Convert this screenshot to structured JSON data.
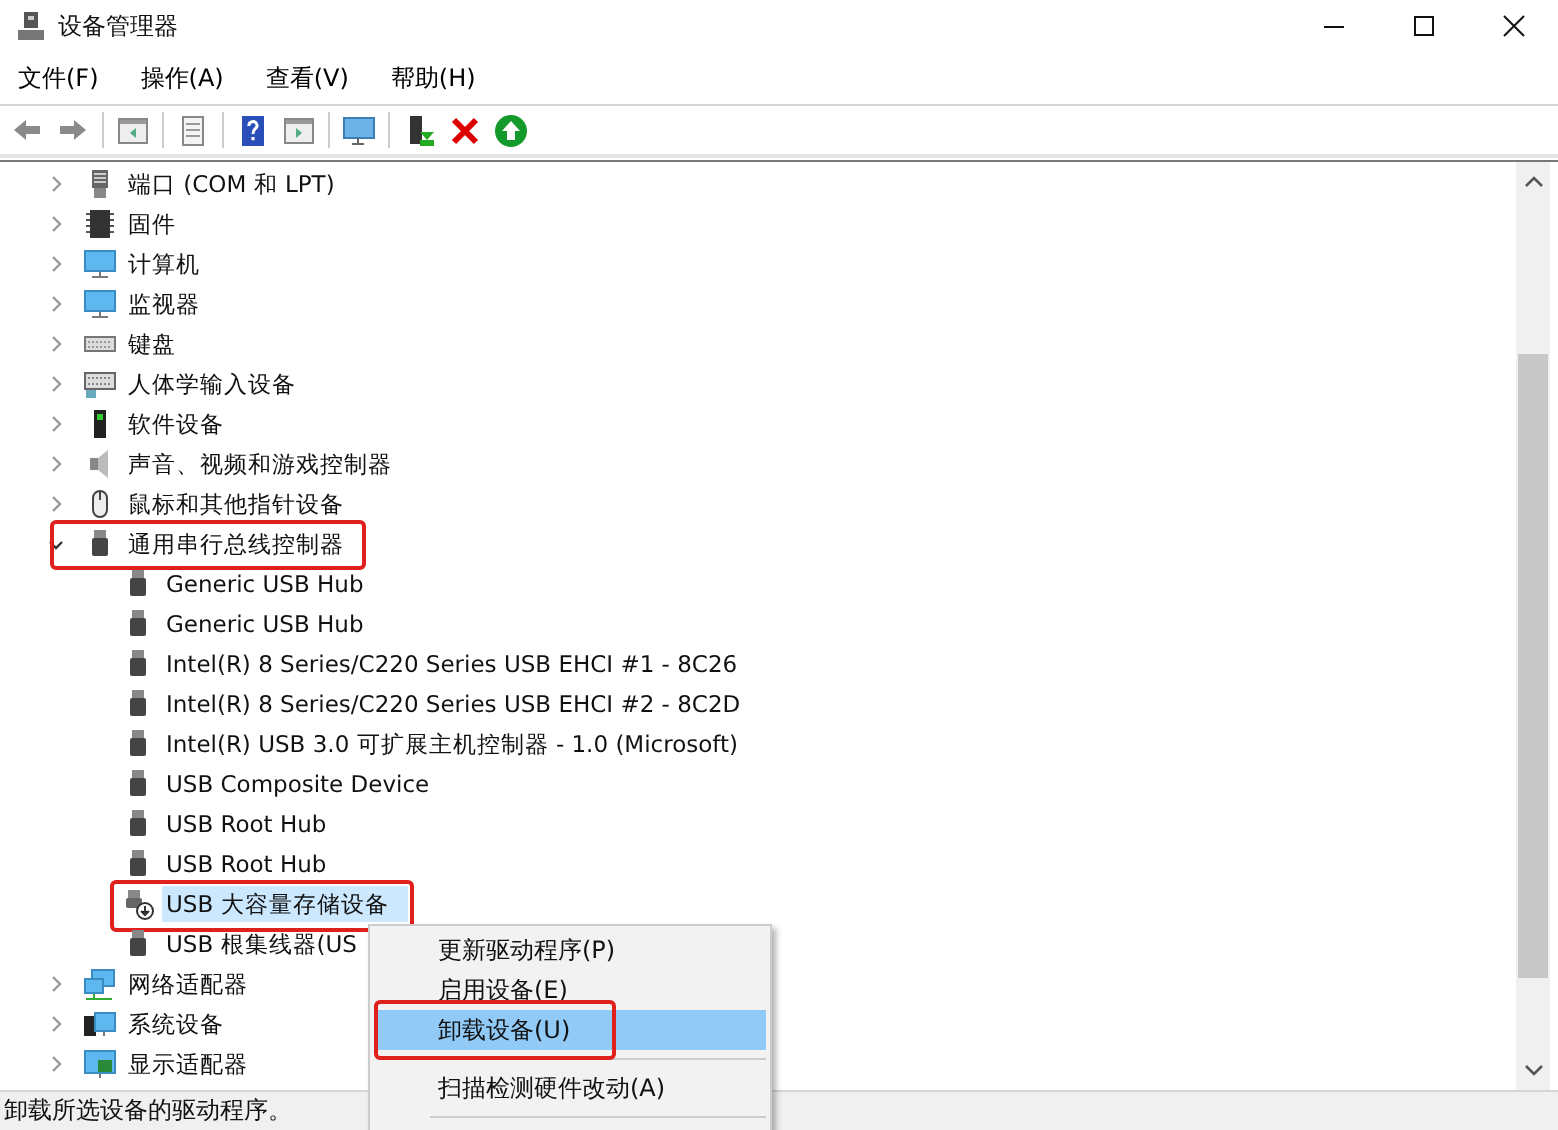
{
  "window": {
    "title": "设备管理器"
  },
  "menu": [
    "文件(F)",
    "操作(A)",
    "查看(V)",
    "帮助(H)"
  ],
  "toolbar": [
    {
      "kind": "back"
    },
    {
      "kind": "forward"
    },
    {
      "kind": "sep"
    },
    {
      "kind": "tree"
    },
    {
      "kind": "sep"
    },
    {
      "kind": "properties"
    },
    {
      "kind": "sep"
    },
    {
      "kind": "help"
    },
    {
      "kind": "pane"
    },
    {
      "kind": "sep"
    },
    {
      "kind": "scan"
    },
    {
      "kind": "sep"
    },
    {
      "kind": "update"
    },
    {
      "kind": "remove"
    },
    {
      "kind": "enable"
    }
  ],
  "tree": [
    {
      "label": "端口 (COM 和 LPT)",
      "kind": "port",
      "expanded": false,
      "annotated": false
    },
    {
      "label": "固件",
      "kind": "chip",
      "expanded": false,
      "annotated": false
    },
    {
      "label": "计算机",
      "kind": "monitor",
      "expanded": false,
      "annotated": false
    },
    {
      "label": "监视器",
      "kind": "monitor",
      "expanded": false,
      "annotated": false
    },
    {
      "label": "键盘",
      "kind": "keyboard",
      "expanded": false,
      "annotated": false
    },
    {
      "label": "人体学输入设备",
      "kind": "hid",
      "expanded": false,
      "annotated": false
    },
    {
      "label": "软件设备",
      "kind": "software",
      "expanded": false,
      "annotated": false
    },
    {
      "label": "声音、视频和游戏控制器",
      "kind": "speaker",
      "expanded": false,
      "annotated": false
    },
    {
      "label": "鼠标和其他指针设备",
      "kind": "mouse",
      "expanded": false,
      "annotated": false
    },
    {
      "label": "通用串行总线控制器",
      "kind": "usb",
      "expanded": true,
      "annotated": true,
      "children": [
        {
          "label": "Generic USB Hub",
          "kind": "usb",
          "selected": false,
          "disabled": false,
          "annotated": false
        },
        {
          "label": "Generic USB Hub",
          "kind": "usb",
          "selected": false,
          "disabled": false,
          "annotated": false
        },
        {
          "label": "Intel(R) 8 Series/C220 Series USB EHCI #1 - 8C26",
          "kind": "usb",
          "selected": false,
          "disabled": false,
          "annotated": false
        },
        {
          "label": "Intel(R) 8 Series/C220 Series USB EHCI #2 - 8C2D",
          "kind": "usb",
          "selected": false,
          "disabled": false,
          "annotated": false
        },
        {
          "label": "Intel(R) USB 3.0 可扩展主机控制器 - 1.0 (Microsoft)",
          "kind": "usb",
          "selected": false,
          "disabled": false,
          "annotated": false
        },
        {
          "label": "USB Composite Device",
          "kind": "usb",
          "selected": false,
          "disabled": false,
          "annotated": false
        },
        {
          "label": "USB Root Hub",
          "kind": "usb",
          "selected": false,
          "disabled": false,
          "annotated": false
        },
        {
          "label": "USB Root Hub",
          "kind": "usb",
          "selected": false,
          "disabled": false,
          "annotated": false
        },
        {
          "label": "USB 大容量存储设备",
          "kind": "usb",
          "selected": true,
          "disabled": true,
          "annotated": true
        },
        {
          "label": "USB 根集线器(US",
          "kind": "usb",
          "selected": false,
          "disabled": false,
          "annotated": false
        }
      ]
    },
    {
      "label": "网络适配器",
      "kind": "network",
      "expanded": false,
      "annotated": false
    },
    {
      "label": "系统设备",
      "kind": "system",
      "expanded": false,
      "annotated": false
    },
    {
      "label": "显示适配器",
      "kind": "display",
      "expanded": false,
      "annotated": false
    }
  ],
  "context_menu": [
    {
      "kind": "item",
      "label": "更新驱动程序(P)",
      "selected": false,
      "annotated": false
    },
    {
      "kind": "item",
      "label": "启用设备(E)",
      "selected": false,
      "annotated": false
    },
    {
      "kind": "item",
      "label": "卸载设备(U)",
      "selected": true,
      "annotated": true
    },
    {
      "kind": "separator"
    },
    {
      "kind": "item",
      "label": "扫描检测硬件改动(A)",
      "selected": false,
      "annotated": false
    },
    {
      "kind": "separator"
    }
  ],
  "status_bar": "卸载所选设备的驱动程序。"
}
